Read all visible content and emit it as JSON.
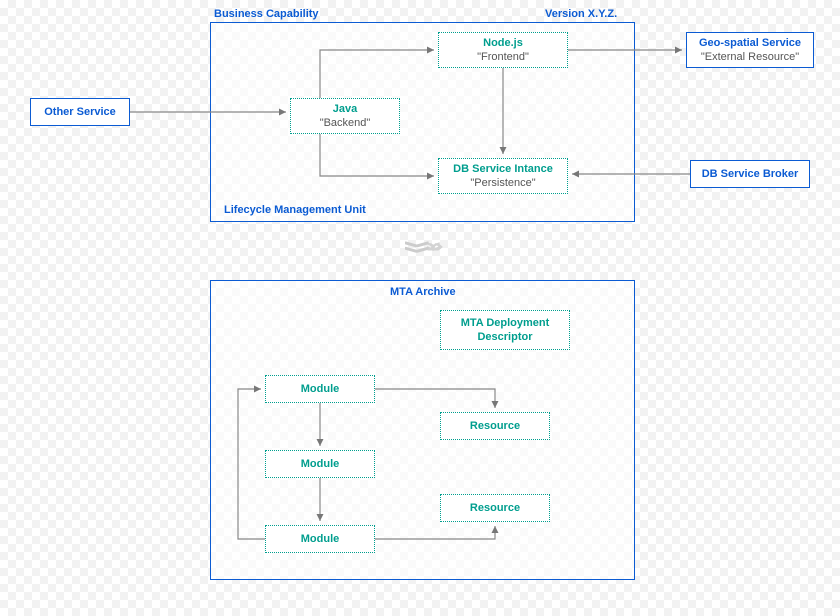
{
  "upper": {
    "title_left": "Business Capability",
    "title_right": "Version X.Y.Z.",
    "footer": "Lifecycle Management Unit",
    "boxes": {
      "java": {
        "tech": "Java",
        "role": "\"Backend\""
      },
      "node": {
        "tech": "Node.js",
        "role": "\"Frontend\""
      },
      "db": {
        "tech": "DB Service Intance",
        "role": "\"Persistence\""
      }
    }
  },
  "left_box": {
    "label": "Other Service"
  },
  "right_top": {
    "label1": "Geo-spatial Service",
    "label2": "\"External Resource\""
  },
  "right_bottom": {
    "label": "DB Service Broker"
  },
  "lower": {
    "title": "MTA Archive",
    "descriptor": {
      "l1": "MTA Deployment",
      "l2": "Descriptor"
    },
    "module1": "Module",
    "module2": "Module",
    "module3": "Module",
    "resource1": "Resource",
    "resource2": "Resource"
  }
}
